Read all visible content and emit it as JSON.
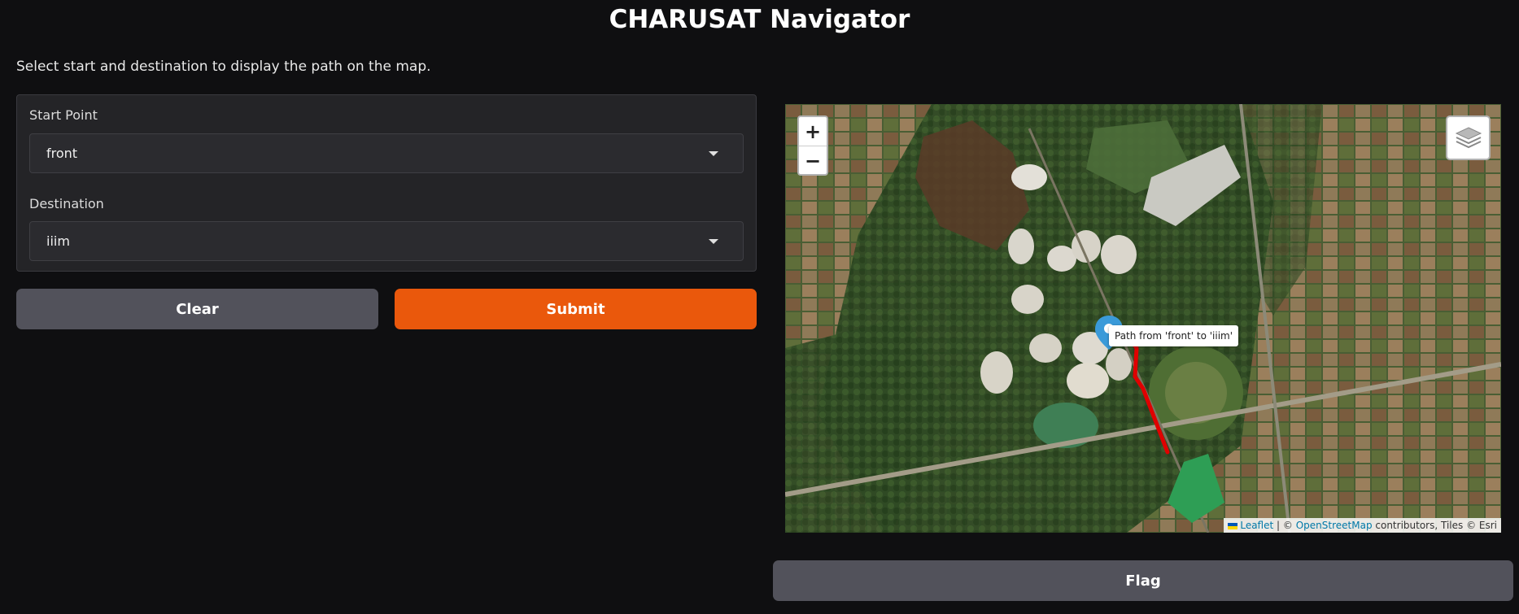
{
  "header": {
    "title": "CHARUSAT Navigator",
    "subtitle": "Select start and destination to display the path on the map."
  },
  "form": {
    "start": {
      "label": "Start Point",
      "value": "front"
    },
    "destination": {
      "label": "Destination",
      "value": "iiim"
    }
  },
  "buttons": {
    "clear": "Clear",
    "submit": "Submit",
    "flag": "Flag"
  },
  "map": {
    "zoom_in": "+",
    "zoom_out": "−",
    "tooltip": "Path from 'front' to 'iiim'",
    "path_color": "#e00000",
    "marker_color": "#3a9ad9",
    "attribution": {
      "leaflet": "Leaflet",
      "sep": "| ©",
      "osm": "OpenStreetMap",
      "rest": "contributors, Tiles © Esri"
    }
  },
  "colors": {
    "accent": "#ea580c",
    "secondary_button": "#52525b",
    "background": "#0f0f11"
  }
}
